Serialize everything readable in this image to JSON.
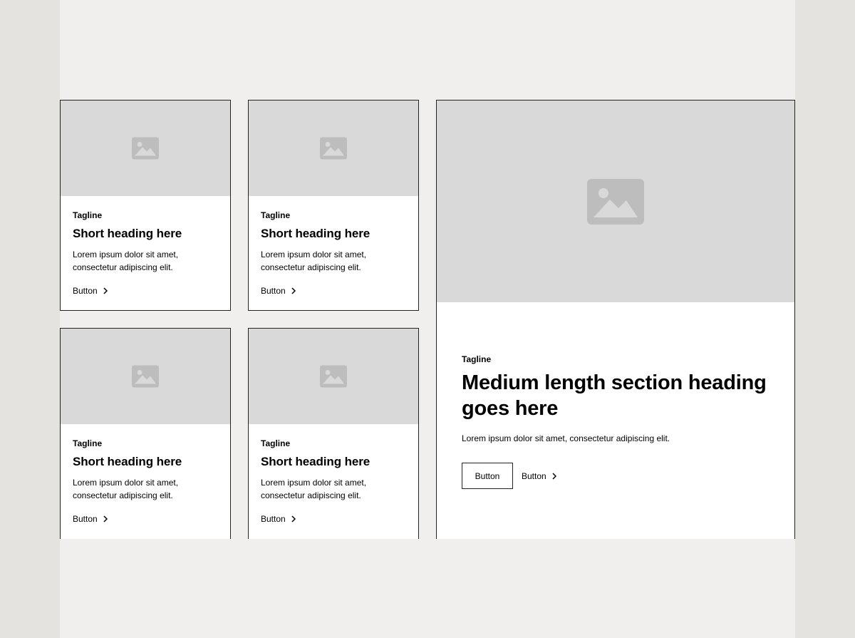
{
  "cards": [
    {
      "tagline": "Tagline",
      "heading": "Short heading here",
      "body": "Lorem ipsum dolor sit amet, consectetur adipiscing elit.",
      "button": "Button",
      "image_icon": "image-placeholder-icon"
    },
    {
      "tagline": "Tagline",
      "heading": "Short heading here",
      "body": "Lorem ipsum dolor sit amet, consectetur adipiscing elit.",
      "button": "Button",
      "image_icon": "image-placeholder-icon"
    },
    {
      "tagline": "Tagline",
      "heading": "Short heading here",
      "body": "Lorem ipsum dolor sit amet, consectetur adipiscing elit.",
      "button": "Button",
      "image_icon": "image-placeholder-icon"
    },
    {
      "tagline": "Tagline",
      "heading": "Short heading here",
      "body": "Lorem ipsum dolor sit amet, consectetur adipiscing elit.",
      "button": "Button",
      "image_icon": "image-placeholder-icon"
    }
  ],
  "feature": {
    "tagline": "Tagline",
    "heading": "Medium length section heading goes here",
    "body": "Lorem ipsum dolor sit amet, consectetur adipiscing elit.",
    "primary_button": "Button",
    "secondary_button": "Button",
    "image_icon": "image-placeholder-icon"
  },
  "colors": {
    "outer_background": "#e4e3df",
    "page_background": "#f0efed",
    "image_placeholder": "#d9d9d9",
    "placeholder_icon": "#bdbdbd",
    "border": "#222222"
  }
}
